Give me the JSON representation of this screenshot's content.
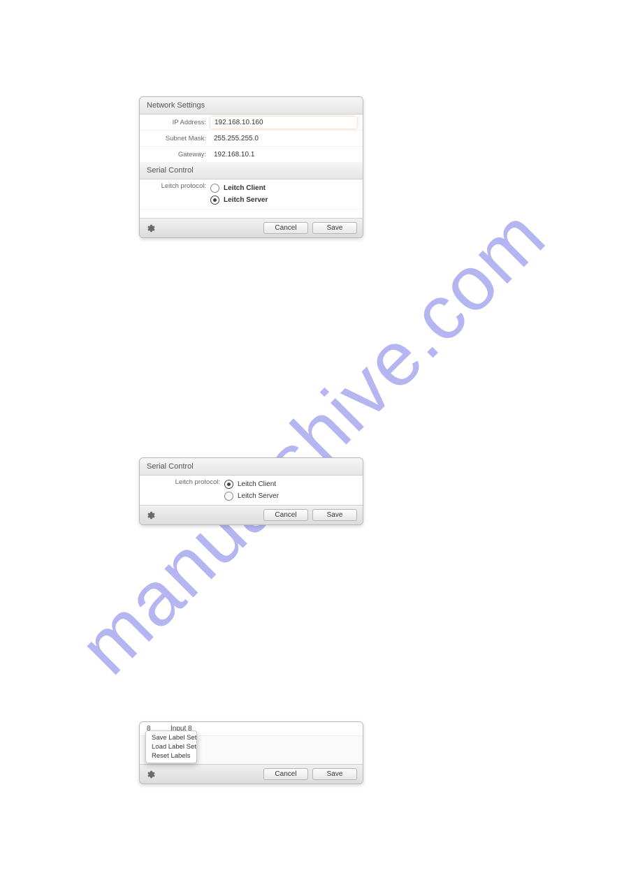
{
  "watermark": "manualshive.com",
  "panel1": {
    "network": {
      "title": "Network Settings",
      "ip_label": "IP Address:",
      "ip_value": "192.168.10.160",
      "subnet_label": "Subnet Mask:",
      "subnet_value": "255.255.255.0",
      "gateway_label": "Gateway:",
      "gateway_value": "192.168.10.1"
    },
    "serial": {
      "title": "Serial Control",
      "protocol_label": "Leitch protocol:",
      "option_client": "Leitch Client",
      "option_server": "Leitch Server",
      "selected": "server"
    },
    "buttons": {
      "cancel": "Cancel",
      "save": "Save"
    }
  },
  "panel2": {
    "serial": {
      "title": "Serial Control",
      "protocol_label": "Leitch protocol:",
      "option_client": "Leitch Client",
      "option_server": "Leitch Server",
      "selected": "client"
    },
    "buttons": {
      "cancel": "Cancel",
      "save": "Save"
    }
  },
  "panel3": {
    "row": {
      "index": "8",
      "label": "Input 8"
    },
    "menu": {
      "save": "Save Label Set",
      "load": "Load Label Set",
      "reset": "Reset Labels"
    },
    "buttons": {
      "cancel": "Cancel",
      "save": "Save"
    }
  }
}
